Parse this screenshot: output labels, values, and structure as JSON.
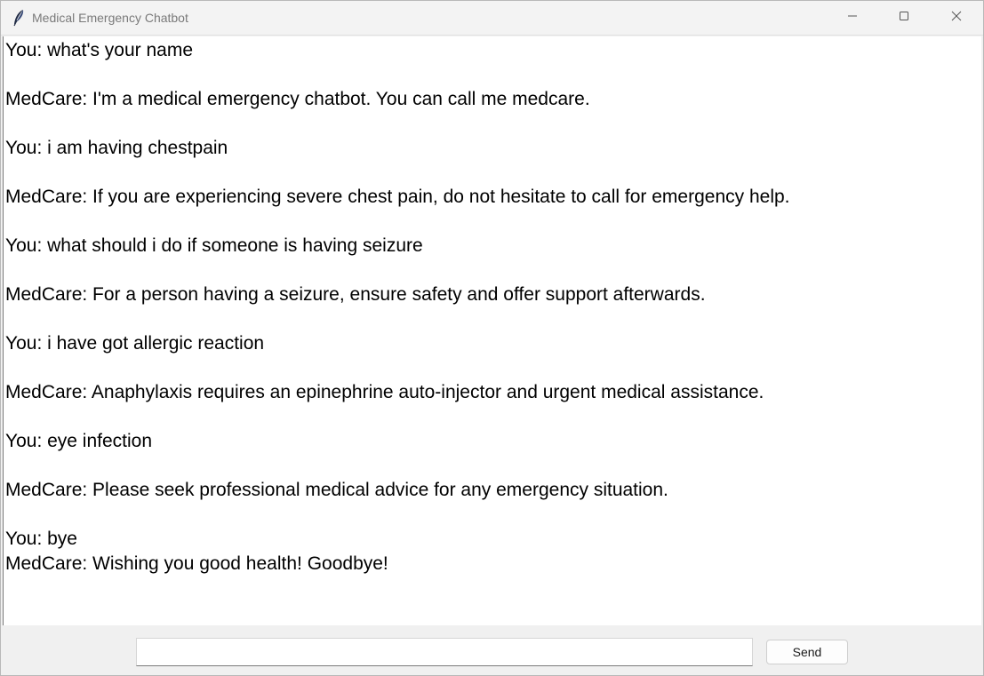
{
  "window": {
    "title": "Medical Emergency Chatbot",
    "app_icon": "feather-icon",
    "controls": [
      "minimize-icon",
      "maximize-icon",
      "close-icon"
    ]
  },
  "chat": {
    "messages": [
      "You: what's your name",
      "MedCare: I'm a medical emergency chatbot. You can call me medcare.",
      "You: i am having chestpain",
      "MedCare: If you are experiencing severe chest pain, do not hesitate to call for emergency help.",
      "You: what should i do if someone is having seizure",
      "MedCare: For a person having a seizure, ensure safety and offer support afterwards.",
      "You: i have got allergic reaction",
      "MedCare: Anaphylaxis requires an epinephrine auto-injector and urgent medical assistance.",
      "You: eye infection",
      "MedCare: Please seek professional medical advice for any emergency situation.",
      "You: bye",
      "MedCare: Wishing you good health! Goodbye!"
    ]
  },
  "input": {
    "value": "",
    "placeholder": ""
  },
  "send_button": {
    "label": "Send"
  }
}
